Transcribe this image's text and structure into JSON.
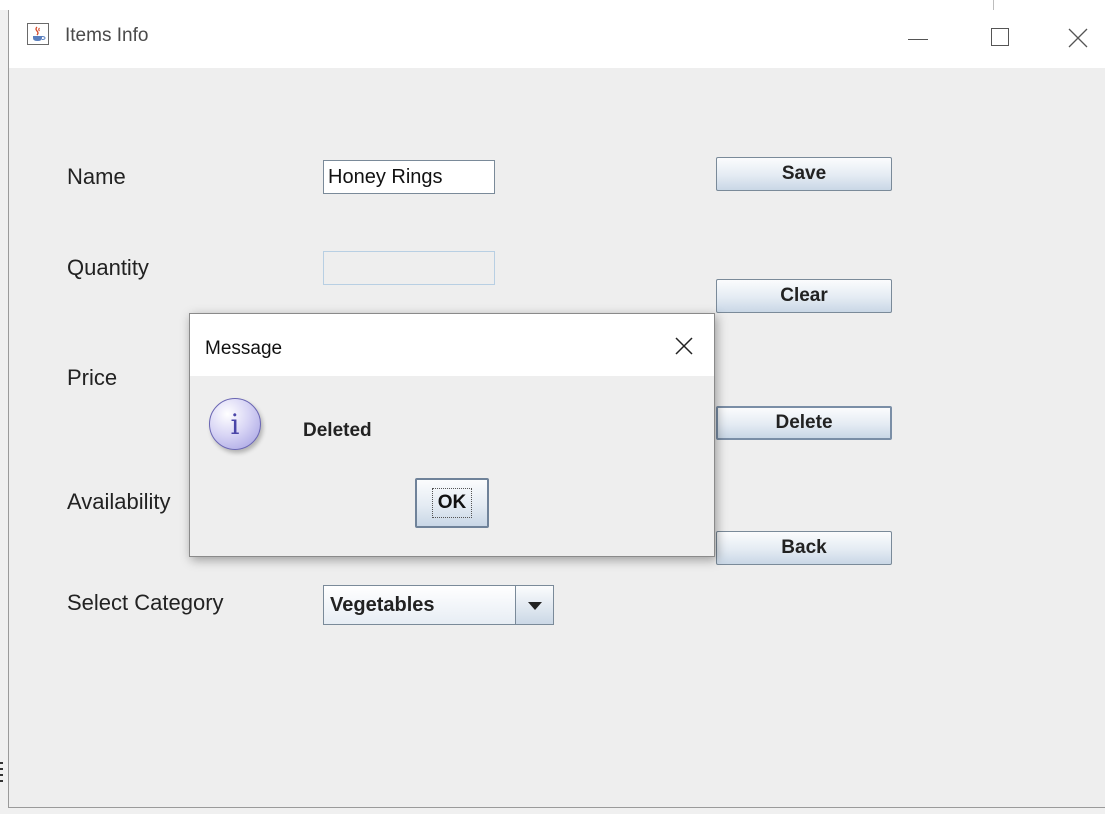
{
  "window": {
    "title": "Items Info",
    "icon": "java-cup-icon",
    "controls": [
      "minimize-icon",
      "maximize-icon",
      "close-icon"
    ]
  },
  "form": {
    "name_label": "Name",
    "name_value": "Honey Rings",
    "quantity_label": "Quantity",
    "quantity_value": "",
    "price_label": "Price",
    "availability_label": "Availability",
    "category_label": "Select Category",
    "category_value": "Vegetables"
  },
  "buttons": {
    "save": "Save",
    "clear": "Clear",
    "delete": "Delete",
    "back": "Back"
  },
  "dialog": {
    "title": "Message",
    "icon": "info-icon",
    "message": "Deleted",
    "ok_label": "OK"
  },
  "colors": {
    "window_bg": "#eeeeee",
    "titlebar_bg": "#ffffff",
    "button_border": "#7a8a99",
    "info_icon": "#9f9be0"
  }
}
